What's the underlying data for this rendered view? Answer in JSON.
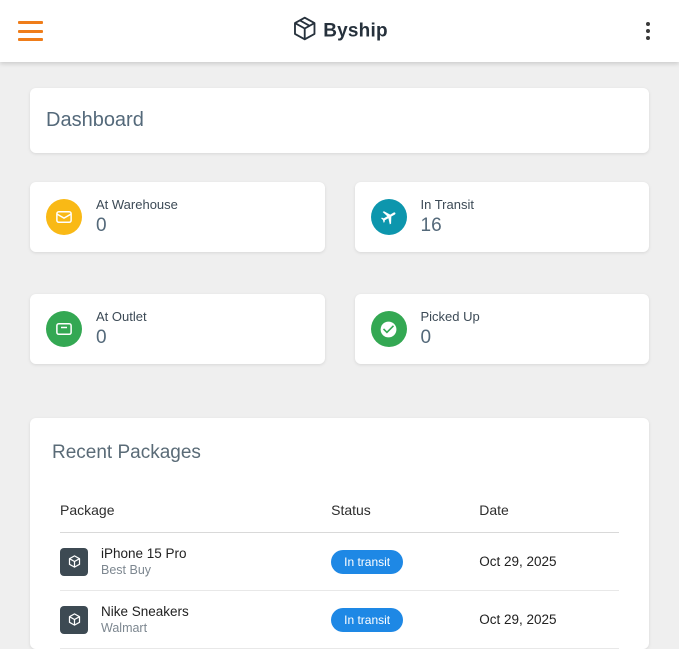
{
  "header": {
    "title": "Byship"
  },
  "dashboard": {
    "title": "Dashboard"
  },
  "stats": [
    {
      "label": "At Warehouse",
      "value": "0",
      "icon": "envelope-icon",
      "color": "#f9b916"
    },
    {
      "label": "In Transit",
      "value": "16",
      "icon": "plane-icon",
      "color": "#0d96ad"
    },
    {
      "label": "At Outlet",
      "value": "0",
      "icon": "archive-icon",
      "color": "#34a853"
    },
    {
      "label": "Picked Up",
      "value": "0",
      "icon": "check-circle-icon",
      "color": "#34a853"
    }
  ],
  "recent_packages": {
    "title": "Recent Packages",
    "columns": [
      "Package",
      "Status",
      "Date"
    ],
    "rows": [
      {
        "name": "iPhone 15 Pro",
        "store": "Best Buy",
        "status": "In transit",
        "date": "Oct 29, 2025"
      },
      {
        "name": "Nike Sneakers",
        "store": "Walmart",
        "status": "In transit",
        "date": "Oct 29, 2025"
      }
    ]
  },
  "colors": {
    "hamburger": "#ef7d1a",
    "status_badge": "#1e88e5",
    "logo_text": "#26313c"
  }
}
